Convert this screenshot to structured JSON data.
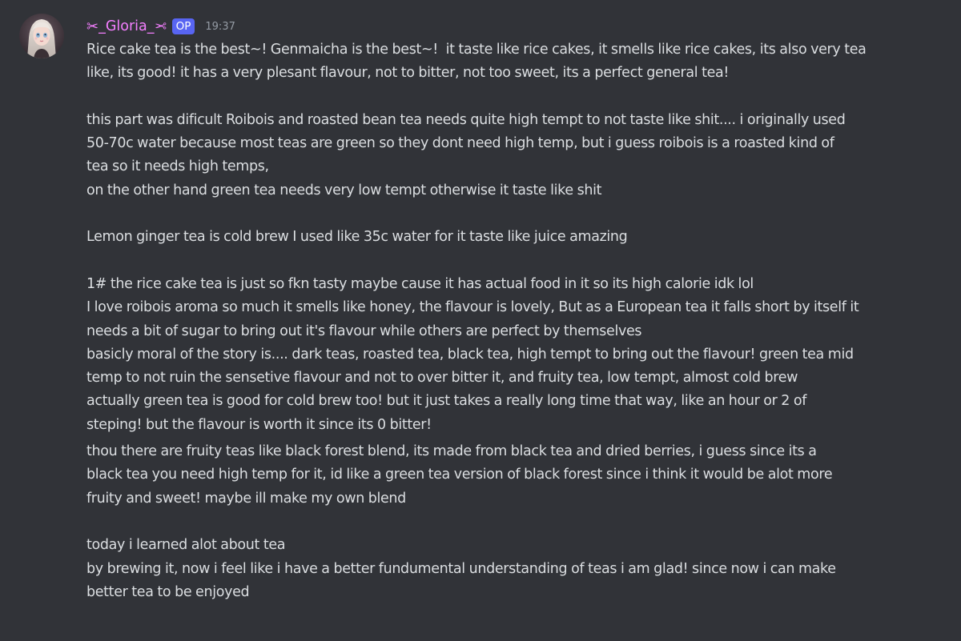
{
  "message": {
    "author": {
      "name": "_Gloria_",
      "badge": "OP",
      "avatar_icon": "avatar-anime-girl",
      "name_color": "#f47fff",
      "decoration_icon": "scissors-icon"
    },
    "timestamp": "19:37",
    "paragraphs": [
      {
        "lines": [
          "Rice cake tea is the best~! Genmaicha is the best~!  it taste like rice cakes, it smells like rice cakes, its also very tea",
          "like, its good! it has a very plesant flavour, not to bitter, not too sweet, its a perfect general tea!"
        ]
      },
      {
        "lines": [
          "this part was dificult Roibois and roasted bean tea needs quite high tempt to not taste like shit.... i originally used",
          "50-70c water because most teas are green so they dont need high temp, but i guess roibois is a roasted kind of",
          "tea so it needs high temps,",
          "on the other hand green tea needs very low tempt otherwise it taste like shit"
        ]
      },
      {
        "lines": [
          "Lemon ginger tea is cold brew I used like 35c water for it taste like juice amazing"
        ]
      },
      {
        "lines": [
          "1# the rice cake tea is just so fkn tasty maybe cause it has actual food in it so its high calorie idk lol",
          "I love roibois aroma so much it smells like honey, the flavour is lovely, But as a European tea it falls short by itself it",
          "needs a bit of sugar to bring out it's flavour while others are perfect by themselves",
          "basicly moral of the story is.... dark teas, roasted tea, black tea, high tempt to bring out the flavour! green tea mid",
          "temp to not ruin the sensetive flavour and not to over bitter it, and fruity tea, low tempt, almost cold brew",
          "actually green tea is good for cold brew too! but it just takes a really long time that way, like an hour or 2 of",
          "steping! but the flavour is worth it since its 0 bitter!"
        ]
      },
      {
        "lines": [
          "thou there are fruity teas like black forest blend, its made from black tea and dried berries, i guess since its a",
          "black tea you need high temp for it, id like a green tea version of black forest since i think it would be alot more",
          "fruity and sweet! maybe ill make my own blend"
        ]
      },
      {
        "lines": [
          "today i learned alot about tea",
          "by brewing it, now i feel like i have a better fundumental understanding of teas i am glad! since now i can make",
          "better tea to be enjoyed"
        ]
      }
    ]
  }
}
